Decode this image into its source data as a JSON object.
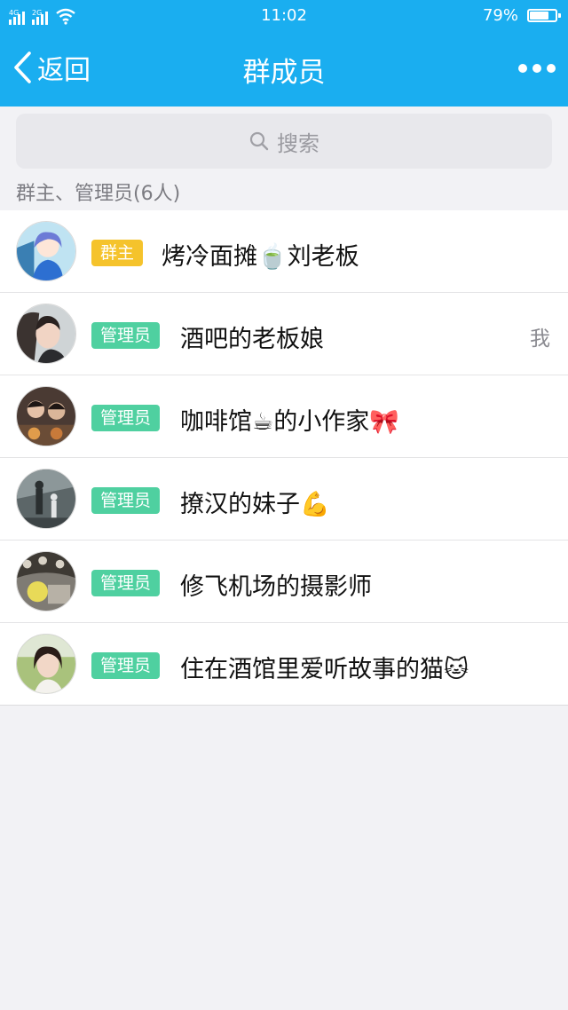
{
  "status_bar": {
    "signal_1": "4G",
    "signal_2": "2G",
    "time": "11:02",
    "battery_text": "79%",
    "battery_level": 0.79
  },
  "nav": {
    "back_label": "返回",
    "title": "群成员"
  },
  "search": {
    "placeholder": "搜索"
  },
  "section": {
    "header": "群主、管理员(6人)"
  },
  "members": [
    {
      "role": "群主",
      "name": "烤冷面摊🍵刘老板",
      "self_label": ""
    },
    {
      "role": "管理员",
      "name": "酒吧的老板娘",
      "self_label": "我"
    },
    {
      "role": "管理员",
      "name": "咖啡馆☕的小作家🎀",
      "self_label": ""
    },
    {
      "role": "管理员",
      "name": "撩汉的妹子💪",
      "self_label": ""
    },
    {
      "role": "管理员",
      "name": "修飞机场的摄影师",
      "self_label": ""
    },
    {
      "role": "管理员",
      "name": "住在酒馆里爱听故事的猫🐱",
      "self_label": ""
    }
  ],
  "colors": {
    "primary": "#1aaef0",
    "owner_badge": "#f5c32c",
    "admin_badge": "#4fd0a0"
  }
}
